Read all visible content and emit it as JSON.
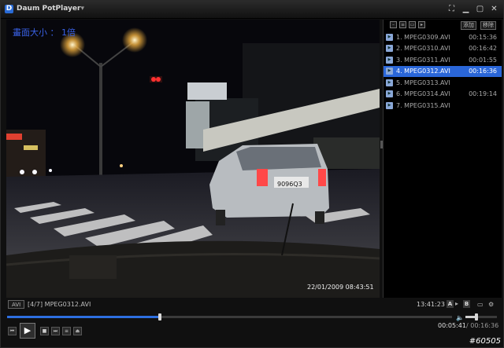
{
  "window": {
    "logo_letter": "D",
    "brand": "Daum ",
    "product": "PotPlayer",
    "dropdown": "▾"
  },
  "osd": {
    "screen_size": "畫面大小 ： 1倍",
    "video_timestamp": "22/01/2009 08:43:51",
    "plate": "9096Q3"
  },
  "playlist": {
    "buttons": {
      "add": "添加",
      "remove": "移除"
    },
    "items": [
      {
        "label": "1. MPEG0309.AVI",
        "duration": "00:15:36",
        "active": false
      },
      {
        "label": "2. MPEG0310.AVI",
        "duration": "00:16:42",
        "active": false
      },
      {
        "label": "3. MPEG0311.AVI",
        "duration": "00:01:55",
        "active": false
      },
      {
        "label": "4. MPEG0312.AVI",
        "duration": "00:16:36",
        "active": true
      },
      {
        "label": "5. MPEG0313.AVI",
        "duration": "",
        "active": false
      },
      {
        "label": "6. MPEG0314.AVI",
        "duration": "00:19:14",
        "active": false
      },
      {
        "label": "7. MPEG0315.AVI",
        "duration": "",
        "active": false
      }
    ]
  },
  "info": {
    "format": "AVI",
    "file": "[4/7] MPEG0312.AVI",
    "clock": "13:41:23",
    "a_label": "A",
    "b_label": "B"
  },
  "playback": {
    "current": "00:05:41",
    "total": "/ 00:16:36",
    "progress_fraction": 0.3425,
    "volume_fraction": 0.35
  },
  "watermark": "#60505"
}
